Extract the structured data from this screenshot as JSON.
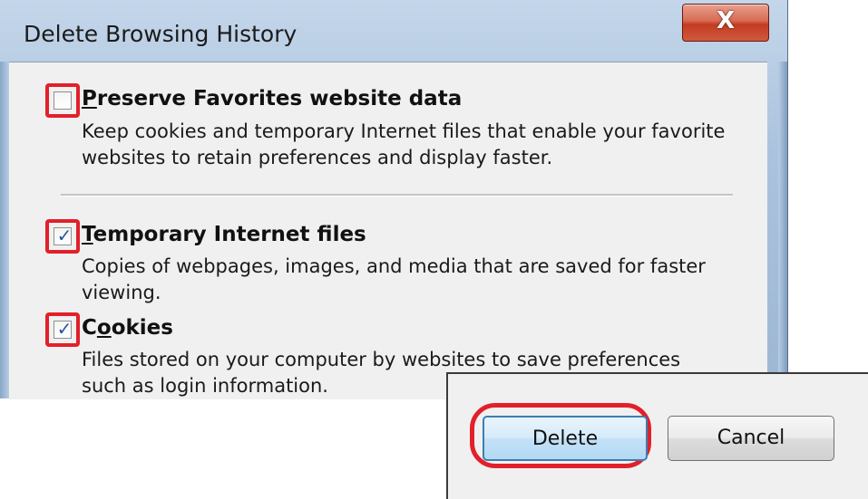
{
  "window": {
    "title": "Delete Browsing History",
    "close_glyph": "X"
  },
  "items": [
    {
      "title_accel": "P",
      "title_rest": "reserve Favorites website data",
      "description_lines": [
        "Keep cookies and temporary Internet files that enable your favorite",
        "websites to retain preferences and display faster."
      ],
      "checked": false,
      "check_glyph": ""
    },
    {
      "title_accel": "T",
      "title_rest": "emporary Internet files",
      "description_lines": [
        "Copies of webpages, images, and media that are saved for faster",
        "viewing."
      ],
      "checked": true,
      "check_glyph": "✓"
    },
    {
      "title_prefix": "C",
      "title_accel": "o",
      "title_rest": "okies",
      "description_lines": [
        "Files stored on your computer by websites to save preferences",
        "such as login information."
      ],
      "checked": true,
      "check_glyph": "✓"
    }
  ],
  "buttons": {
    "delete_label": "Delete",
    "cancel_label": "Cancel"
  },
  "link_peek_text": "…",
  "colors": {
    "highlight": "#e2202a",
    "check": "#2c54a0",
    "dialog_bg": "#f0f0f0",
    "title_bar": "#aac2dd"
  }
}
